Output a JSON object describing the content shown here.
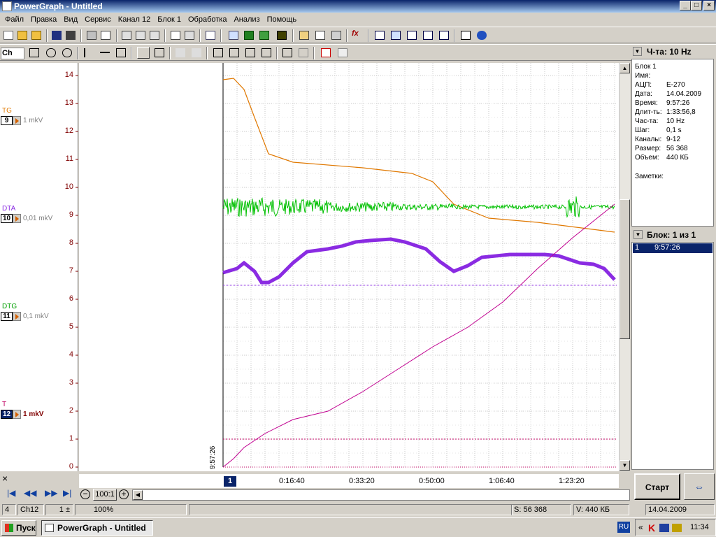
{
  "window": {
    "title": "PowerGraph - Untitled",
    "min": "_",
    "max": "□",
    "close": "×"
  },
  "menu": [
    "Файл",
    "Правка",
    "Вид",
    "Сервис",
    "Канал 12",
    "Блок 1",
    "Обработка",
    "Анализ",
    "Помощь"
  ],
  "toolbar2": {
    "ch": "Ch"
  },
  "channels": [
    {
      "name": "TG",
      "num": "9",
      "unit": "1 mkV",
      "color": "#e07800"
    },
    {
      "name": "DTA",
      "num": "10",
      "unit": "0,01 mkV",
      "color": "#8a2be2"
    },
    {
      "name": "DTG",
      "num": "11",
      "unit": "0,1 mkV",
      "color": "#00a000"
    },
    {
      "name": "T",
      "num": "12",
      "unit": "1 mkV",
      "color": "#c00060"
    }
  ],
  "yaxis": [
    "14",
    "13",
    "12",
    "11",
    "10",
    "9",
    "8",
    "7",
    "6",
    "5",
    "4",
    "3",
    "2",
    "1",
    "0"
  ],
  "start_time": "9:57:26",
  "time_ticks": [
    "0:16:40",
    "0:33:20",
    "0:50:00",
    "1:06:40",
    "1:23:20"
  ],
  "block_marker": "1",
  "right": {
    "freq": "Ч-та: 10 Hz",
    "info": [
      [
        "Блок 1",
        ""
      ],
      [
        "Имя:",
        ""
      ],
      [
        "АЦП:",
        "E-270"
      ],
      [
        "Дата:",
        "14.04.2009"
      ],
      [
        "Время:",
        "9:57:26"
      ],
      [
        "Длит-ть:",
        "1:33:56,8"
      ],
      [
        "Час-та:",
        "10 Hz"
      ],
      [
        "Шаг:",
        "0,1 s"
      ],
      [
        "Каналы:",
        "9-12"
      ],
      [
        "Размер:",
        "56 368"
      ],
      [
        "Объем:",
        "440 КБ"
      ]
    ],
    "notes": "Заметки:",
    "block_header": "Блок: 1 из 1",
    "block_item_num": "1",
    "block_item_time": "9:57:26",
    "start_button": "Старт"
  },
  "nav": {
    "close": "×",
    "zoom": "100:1"
  },
  "status": {
    "s1": "4",
    "s2": "Ch12",
    "s3": "1 ±",
    "s4": "100%",
    "s5": "S: 56 368",
    "s6": "V: 440 КБ",
    "s7": "14.04.2009"
  },
  "taskbar": {
    "start": "Пуск",
    "task": "PowerGraph - Untitled",
    "lang": "RU",
    "clock": "11:34",
    "arrows": "«"
  }
}
